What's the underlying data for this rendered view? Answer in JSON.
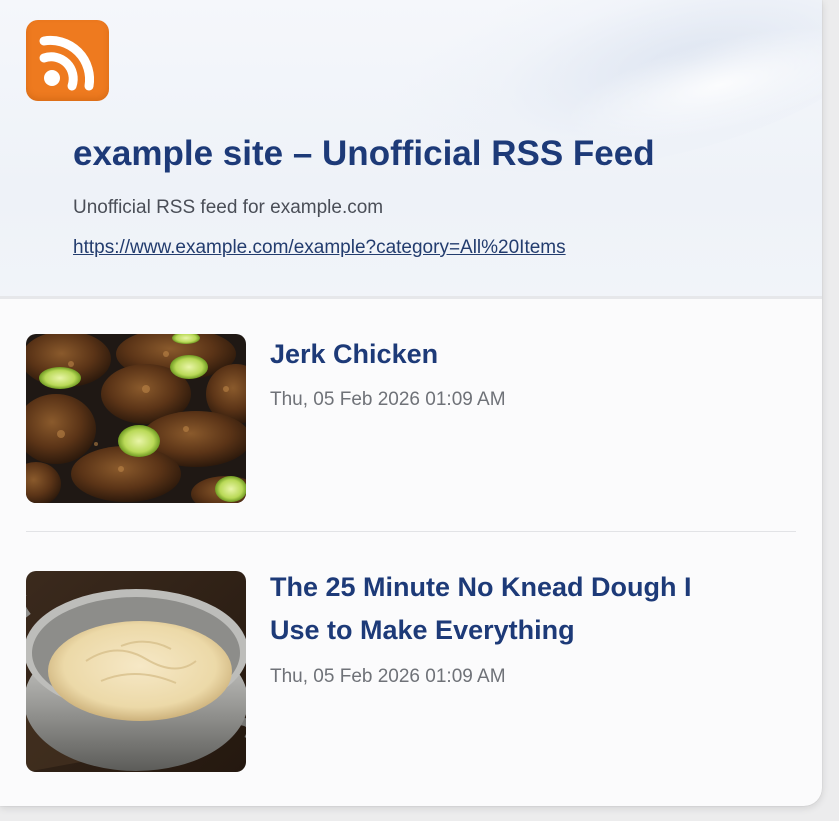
{
  "feed": {
    "title": "example site – Unofficial RSS Feed",
    "description": "Unofficial RSS feed for example.com",
    "link": "https://www.example.com/example?category=All%20Items",
    "logo_icon": "rss-icon",
    "accent_color": "#ee7a1f",
    "title_color": "#1d3a78"
  },
  "items": [
    {
      "title": "Jerk Chicken",
      "date": "Thu, 05 Feb 2026 01:09 AM",
      "thumbnail_icon": "jerk-chicken-photo"
    },
    {
      "title": "The 25 Minute No Knead Dough I Use to Make Everything",
      "date": "Thu, 05 Feb 2026 01:09 AM",
      "thumbnail_icon": "dough-in-pot-photo"
    }
  ]
}
